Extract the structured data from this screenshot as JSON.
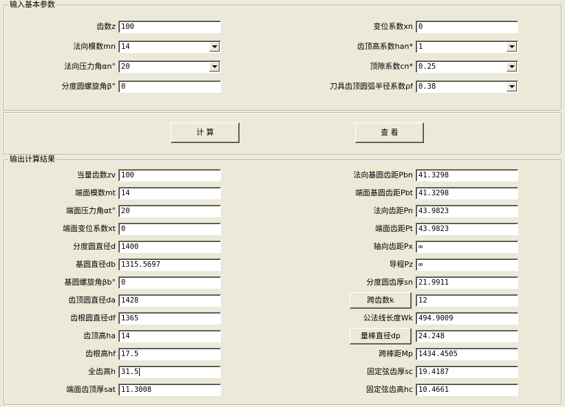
{
  "input_group": {
    "title": "输入基本参数",
    "left": [
      {
        "label": "齿数z",
        "value": "100",
        "combo": false
      },
      {
        "label": "法向模数mn",
        "value": "14",
        "combo": true
      },
      {
        "label": "法向压力角αn°",
        "value": "20",
        "combo": true
      },
      {
        "label": "分度圆螺旋角β°",
        "value": "0",
        "combo": false
      }
    ],
    "right": [
      {
        "label": "变位系数xn",
        "value": "0",
        "combo": false
      },
      {
        "label": "齿顶高系数han*",
        "value": "1",
        "combo": true
      },
      {
        "label": "顶隙系数cn*",
        "value": "0.25",
        "combo": true
      },
      {
        "label": "刀具齿顶圆弧半径系数ρf",
        "value": "0.38",
        "combo": true
      }
    ]
  },
  "actions": {
    "calculate": "计 算",
    "view": "查 看"
  },
  "output_group": {
    "title": "输出计算结果",
    "left": [
      {
        "label": "当量齿数zv",
        "value": "100"
      },
      {
        "label": "端面模数mt",
        "value": "14"
      },
      {
        "label": "端面压力角αt°",
        "value": "20"
      },
      {
        "label": "端面变位系数xt",
        "value": "0"
      },
      {
        "label": "分度圆直径d",
        "value": "1400"
      },
      {
        "label": "基圆直径db",
        "value": "1315.5697"
      },
      {
        "label": "基圆螺旋角βb°",
        "value": "0"
      },
      {
        "label": "齿顶圆直径da",
        "value": "1428"
      },
      {
        "label": "齿根圆直径df",
        "value": "1365"
      },
      {
        "label": "齿顶高ha",
        "value": "14"
      },
      {
        "label": "齿根高hf",
        "value": "17.5"
      },
      {
        "label": "全齿高h",
        "value": "31.5"
      },
      {
        "label": "端面齿顶厚sat",
        "value": "11.3008"
      }
    ],
    "right": [
      {
        "label": "法向基圆齿距Pbn",
        "value": "41.3298",
        "button": false
      },
      {
        "label": "端面基圆齿距Pbt",
        "value": "41.3298",
        "button": false
      },
      {
        "label": "法向齿距Pn",
        "value": "43.9823",
        "button": false
      },
      {
        "label": "端面齿距Pt",
        "value": "43.9823",
        "button": false
      },
      {
        "label": "轴向齿距Px",
        "value": "∞",
        "button": false
      },
      {
        "label": "导程Pz",
        "value": "∞",
        "button": false
      },
      {
        "label": "分度圆齿厚sn",
        "value": "21.9911",
        "button": false
      },
      {
        "label": "跨齿数k",
        "value": "12",
        "button": true
      },
      {
        "label": "公法线长度Wk",
        "value": "494.9009",
        "button": false
      },
      {
        "label": "量棒直径dp",
        "value": "24.248",
        "button": true
      },
      {
        "label": "跨棒距Mp",
        "value": "1434.4505",
        "button": false
      },
      {
        "label": "固定弦齿厚sc",
        "value": "19.4187",
        "button": false
      },
      {
        "label": "固定弦齿高hc",
        "value": "10.4661",
        "button": false
      }
    ]
  }
}
